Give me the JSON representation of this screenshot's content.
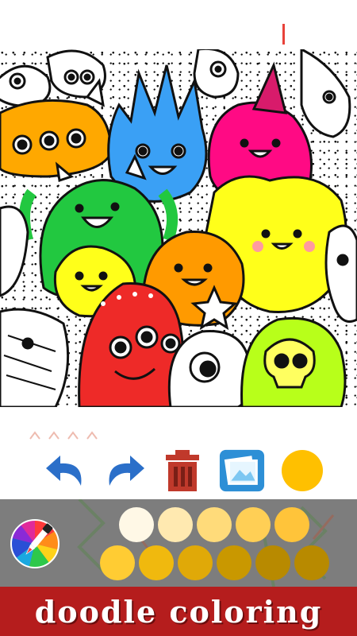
{
  "toolbar": {
    "undo_icon": "undo-arrow-icon",
    "redo_icon": "redo-arrow-icon",
    "delete_icon": "trash-can-icon",
    "gallery_icon": "gallery-photos-icon",
    "current_color": "#ffc000"
  },
  "palette": {
    "swatches": [
      "#fff8e6",
      "#ffe9b0",
      "#ffdb7a",
      "#ffcf55",
      "#ffc43a",
      "#ffcc33",
      "#f0b90e",
      "#e0a908",
      "#c99800",
      "#b88a00"
    ]
  },
  "banner": {
    "title": "doodle coloring"
  },
  "colors": {
    "banner_bg": "#b51d1d",
    "panel_bg": "#7d7d7d",
    "accent": "#e8423a"
  }
}
